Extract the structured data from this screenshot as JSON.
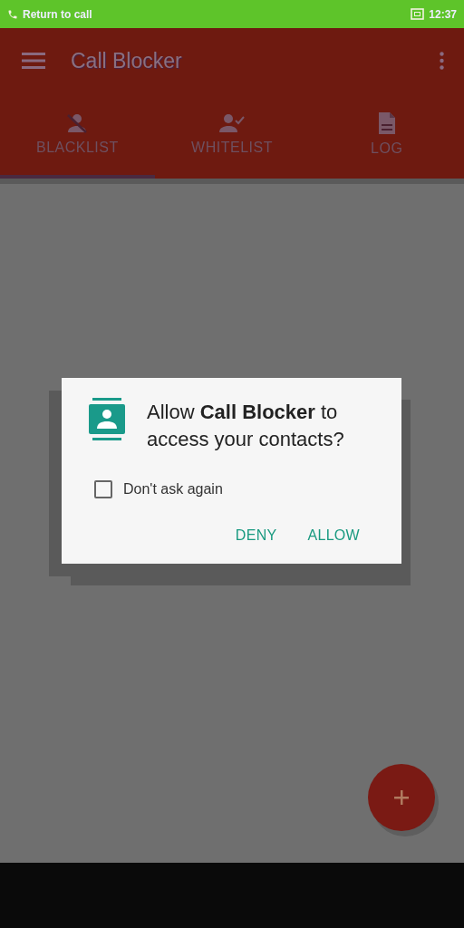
{
  "status_bar": {
    "call_text": "Return to call",
    "time": "12:37"
  },
  "app_bar": {
    "title": "Call Blocker"
  },
  "tabs": [
    {
      "label": "BLACKLIST",
      "kind": "blocked",
      "selected": true
    },
    {
      "label": "WHITELIST",
      "kind": "allowed",
      "selected": false
    },
    {
      "label": "LOG",
      "kind": "log",
      "selected": false
    }
  ],
  "dialog": {
    "message": "Allow **Call Blocker** to\naccess your contacts?",
    "checkbox": {
      "label": "Don't ask again",
      "checked": false
    },
    "buttons": [
      "DENY",
      "ALLOW"
    ]
  }
}
